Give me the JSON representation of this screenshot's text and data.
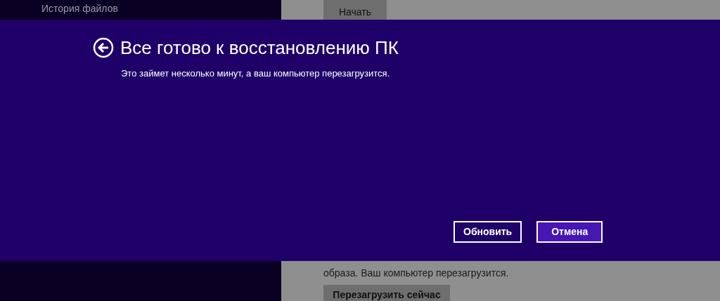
{
  "background": {
    "sidebar_item": "История файлов",
    "start_button": "Начать",
    "text_lines": [
      "образа. Ваш компьютер перезагрузится."
    ],
    "restart_button": "Перезагрузить сейчас"
  },
  "dialog": {
    "title": "Все готово к восстановлению ПК",
    "message": "Это займет несколько минут, а ваш компьютер перезагрузится.",
    "buttons": [
      {
        "label": "Обновить",
        "selected": false
      },
      {
        "label": "Отмена",
        "selected": true
      }
    ]
  }
}
